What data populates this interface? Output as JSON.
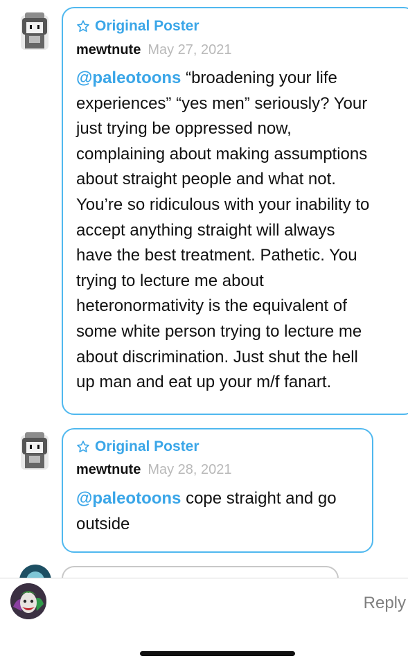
{
  "replies": [
    {
      "badge": "Original Poster",
      "username": "mewtnute",
      "date": "May 27, 2021",
      "mention": "@paleotoons",
      "lines": [
        " “broadening your life",
        "experiences” “yes men” seriously? Your",
        "just trying be oppressed now,",
        "complaining about making assumptions",
        "about straight people and what not.",
        "You’re so ridiculous with your inability to",
        "accept anything straight will always",
        "have the best treatment. Pathetic. You",
        "trying to lecture me about",
        "heteronormativity is the equivalent of",
        "some white person trying to lecture me",
        "about discrimination. Just shut the hell",
        "up man and eat up your m/f fanart."
      ]
    },
    {
      "badge": "Original Poster",
      "username": "mewtnute",
      "date": "May 28, 2021",
      "mention": "@paleotoons",
      "lines": [
        " cope straight and go",
        "outside"
      ]
    }
  ],
  "reply_bar": {
    "button_label": "Reply"
  },
  "colors": {
    "accent": "#3aa6e8",
    "bubble_border": "#4fb8ef",
    "date": "#b9b9b9",
    "reply_text": "#7f7f7f"
  },
  "icons": {
    "badge": "star-outline-icon"
  }
}
